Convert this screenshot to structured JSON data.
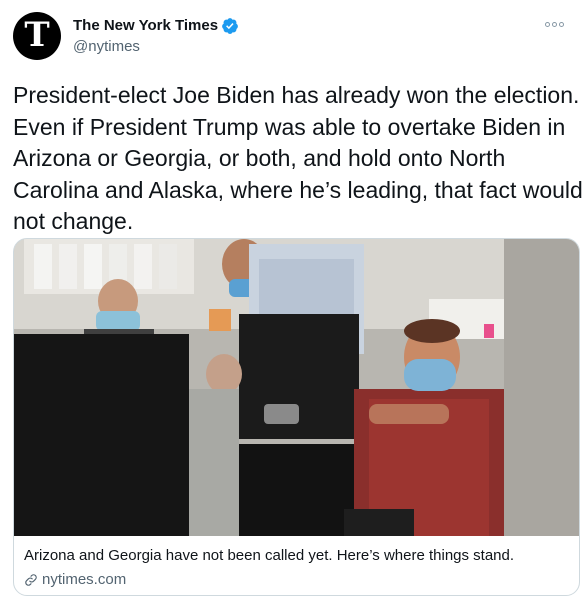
{
  "author": {
    "avatar_glyph": "T",
    "name": "The New York Times",
    "handle": "@nytimes",
    "verified": true
  },
  "tweet": {
    "text": "President-elect Joe Biden has already won the election. Even if President Trump was able to overtake Biden in Arizona or Georgia, or both, and hold onto North Carolina and Alaska, where he’s leading, that fact would not change."
  },
  "card": {
    "caption": "Arizona and Georgia have not been called yet. Here’s where things stand.",
    "domain": "nytimes.com"
  },
  "colors": {
    "text": "#0f1419",
    "secondary": "#536471",
    "verified": "#1d9bf0",
    "border": "#cfd9de"
  },
  "icons": {
    "verified": "verified-badge-icon",
    "link": "link-icon",
    "more": "more-icon"
  }
}
